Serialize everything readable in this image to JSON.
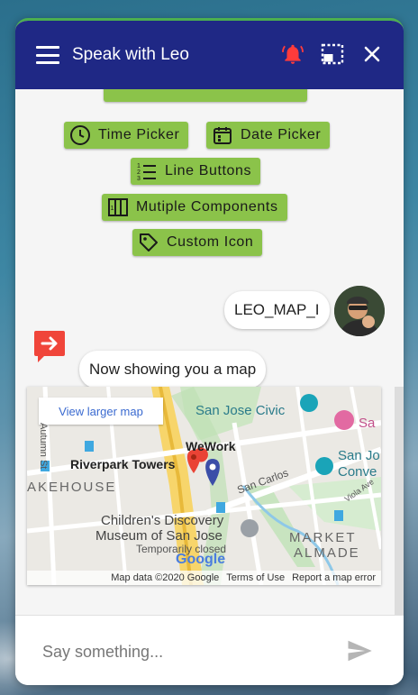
{
  "header": {
    "title": "Speak with Leo"
  },
  "buttons": [
    {
      "label": "Time Picker",
      "icon": "clock-icon"
    },
    {
      "label": "Date Picker",
      "icon": "calendar-icon"
    },
    {
      "label": "Line Buttons",
      "icon": "list-icon"
    },
    {
      "label": "Mutiple Components",
      "icon": "components-icon"
    },
    {
      "label": "Custom Icon",
      "icon": "tag-icon"
    }
  ],
  "messages": {
    "user": "LEO_MAP_I",
    "bot": "Now showing you a map"
  },
  "map": {
    "view_larger": "View larger map",
    "labels": {
      "civic": "San Jose Civic",
      "wework": "WeWork",
      "riverpark": "Riverpark Towers",
      "kehouse": "AKEHOUSE",
      "sancarlos": "San Carlos",
      "museum1": "Children's Discovery",
      "museum2": "Museum of San Jose",
      "closed": "Temporarily closed",
      "sanjo": "San Jo",
      "conve": "Conve",
      "market": "MARKET",
      "almade": "ALMADE",
      "autumn": "Autumn St",
      "viola": "Viola Ave",
      "sa": "Sa",
      "google": "Google"
    },
    "footer": {
      "data": "Map data ©2020 Google",
      "terms": "Terms of Use",
      "report": "Report a map error"
    }
  },
  "input": {
    "placeholder": "Say something..."
  },
  "colors": {
    "header": "#1f2885",
    "pill": "#8bc34a",
    "bell": "#ff3b3b",
    "accent_top": "#4caf50"
  }
}
